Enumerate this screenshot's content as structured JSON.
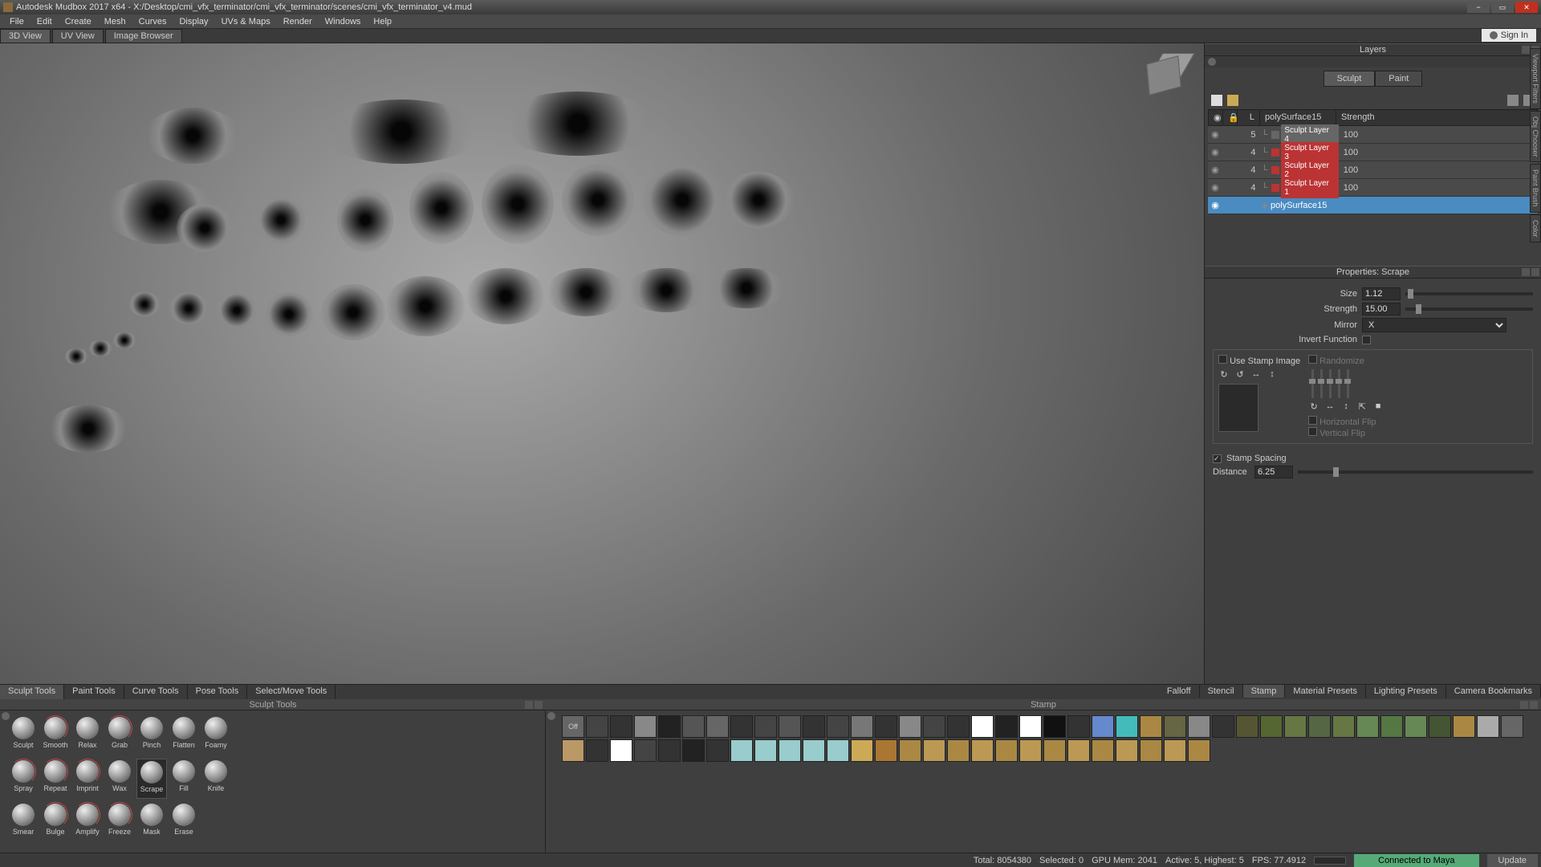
{
  "title": "Autodesk Mudbox 2017 x64 - X:/Desktop/cmi_vfx_terminator/cmi_vfx_terminator/scenes/cmi_vfx_terminator_v4.mud",
  "menus": [
    "File",
    "Edit",
    "Create",
    "Mesh",
    "Curves",
    "Display",
    "UVs & Maps",
    "Render",
    "Windows",
    "Help"
  ],
  "view_tabs": [
    "3D View",
    "UV View",
    "Image Browser"
  ],
  "view_tab_active": 0,
  "signin": "Sign In",
  "layers": {
    "title": "Layers",
    "tabs": [
      "Sculpt",
      "Paint"
    ],
    "tab_active": 0,
    "header": {
      "name": "polySurface15",
      "strength_label": "Strength"
    },
    "rows": [
      {
        "level": "5",
        "name": "Sculpt Layer 4",
        "strength": "100",
        "color": "#666"
      },
      {
        "level": "4",
        "name": "Sculpt Layer 3",
        "strength": "100",
        "color": "#b33"
      },
      {
        "level": "4",
        "name": "Sculpt Layer 2",
        "strength": "100",
        "color": "#b33"
      },
      {
        "level": "4",
        "name": "Sculpt Layer 1",
        "strength": "100",
        "color": "#b33"
      }
    ],
    "selected": {
      "name": "polySurface15"
    }
  },
  "properties": {
    "title": "Properties: Scrape",
    "size_label": "Size",
    "size_value": "1.12",
    "strength_label": "Strength",
    "strength_value": "15.00",
    "mirror_label": "Mirror",
    "mirror_value": "X",
    "invert_label": "Invert Function",
    "stamp_label": "Use Stamp Image",
    "randomize_label": "Randomize",
    "hflip_label": "Horizontal Flip",
    "vflip_label": "Vertical Flip",
    "spacing_label": "Stamp Spacing",
    "distance_label": "Distance",
    "distance_value": "6.25"
  },
  "tool_tabs_left": [
    "Sculpt Tools",
    "Paint Tools",
    "Curve Tools",
    "Pose Tools",
    "Select/Move Tools"
  ],
  "tool_tabs_left_active": 0,
  "tool_tabs_right": [
    "Falloff",
    "Stencil",
    "Stamp",
    "Material Presets",
    "Lighting Presets",
    "Camera Bookmarks"
  ],
  "tool_tabs_right_active": 2,
  "sculpt_sub": "Sculpt Tools",
  "stamp_sub": "Stamp",
  "sculpt_tools": [
    "Sculpt",
    "Smooth",
    "Relax",
    "Grab",
    "Pinch",
    "Flatten",
    "Foamy",
    "Spray",
    "Repeat",
    "Imprint",
    "Wax",
    "Scrape",
    "Fill",
    "Knife",
    "Smear",
    "Bulge",
    "Amplify",
    "Freeze",
    "Mask",
    "Erase"
  ],
  "sculpt_tool_active": 11,
  "stamp_off": "Off",
  "stamp_colors": [
    "#444",
    "#333",
    "#888",
    "#222",
    "#555",
    "#666",
    "#333",
    "#444",
    "#555",
    "#333",
    "#444",
    "#777",
    "#333",
    "#888",
    "#444",
    "#333",
    "#fff",
    "#222",
    "#fff",
    "#111",
    "#333",
    "#68c",
    "#4bb",
    "#a84",
    "#664",
    "#888",
    "#333",
    "#553",
    "#563",
    "#674",
    "#564",
    "#674",
    "#685",
    "#574",
    "#685",
    "#453",
    "#a84",
    "#aaa",
    "#666",
    "#b96",
    "#333",
    "#fff",
    "#444",
    "#333",
    "#222",
    "#333",
    "#9cc",
    "#9cc",
    "#9cc",
    "#9cc",
    "#9cc",
    "#ca5",
    "#a73",
    "#a84",
    "#b95",
    "#a84",
    "#b95",
    "#a84",
    "#b95",
    "#a84",
    "#b95",
    "#a84",
    "#b95",
    "#a84",
    "#b95",
    "#a84"
  ],
  "status": {
    "total": "Total: 8054380",
    "selected": "Selected: 0",
    "gpu": "GPU Mem: 2041",
    "active": "Active: 5, Highest: 5",
    "fps": "FPS: 77.4912",
    "connected": "Connected to Maya",
    "update": "Update"
  },
  "side_tabs": [
    "Viewport Filters",
    "Obj Chooser",
    "Paint Brush",
    "Color"
  ]
}
